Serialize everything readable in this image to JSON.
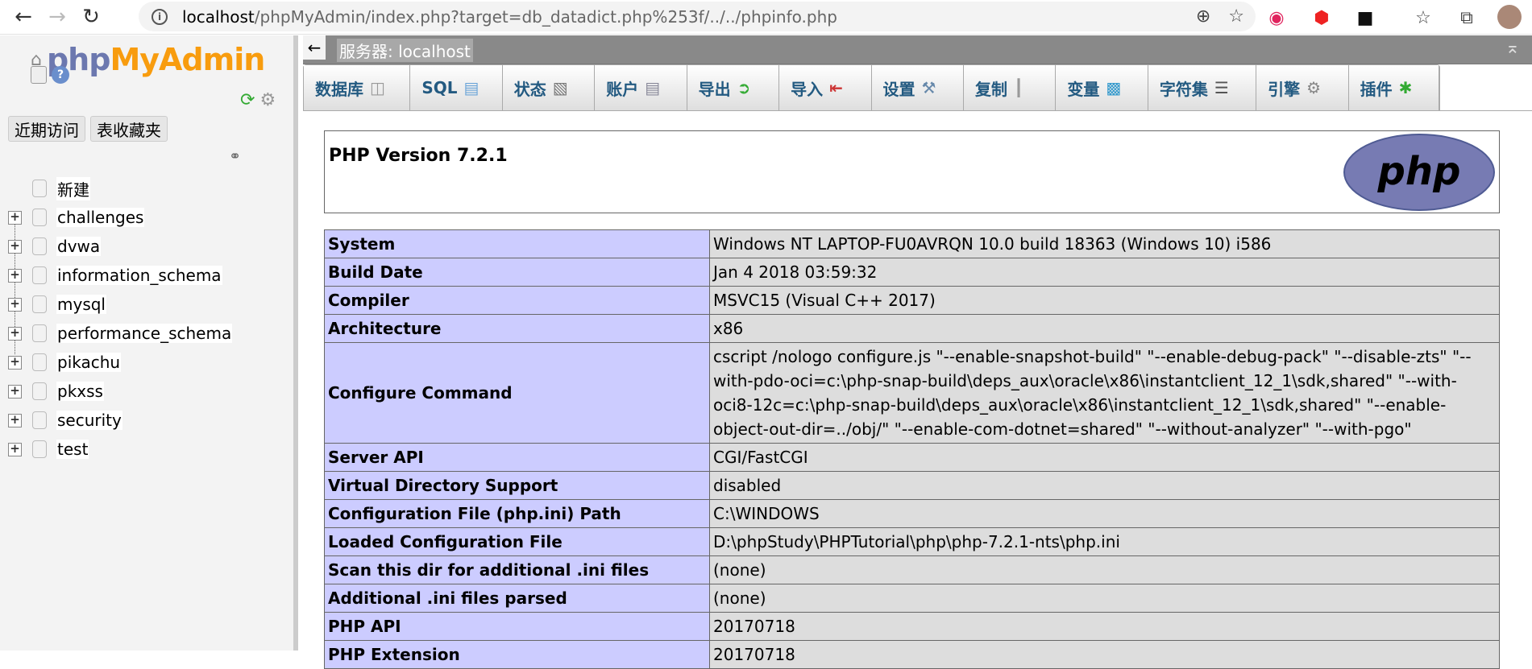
{
  "browser": {
    "url_host": "localhost",
    "url_rest": "/phpMyAdmin/index.php?target=db_datadict.php%253f/../../phpinfo.php"
  },
  "sidebar": {
    "logo_php": "php",
    "logo_myadmin": "MyAdmin",
    "recent_label": "近期访问",
    "favorites_label": "表收藏夹",
    "new_label": "新建",
    "databases": [
      "challenges",
      "dvwa",
      "information_schema",
      "mysql",
      "performance_schema",
      "pikachu",
      "pkxss",
      "security",
      "test"
    ]
  },
  "server_bar": {
    "label": "服务器: localhost"
  },
  "tabs": [
    {
      "label": "数据库",
      "icon": "database-icon"
    },
    {
      "label": "SQL",
      "icon": "sql-icon"
    },
    {
      "label": "状态",
      "icon": "status-icon"
    },
    {
      "label": "账户",
      "icon": "accounts-icon"
    },
    {
      "label": "导出",
      "icon": "export-icon"
    },
    {
      "label": "导入",
      "icon": "import-icon"
    },
    {
      "label": "设置",
      "icon": "settings-icon"
    },
    {
      "label": "复制",
      "icon": "replication-icon"
    },
    {
      "label": "变量",
      "icon": "variables-icon"
    },
    {
      "label": "字符集",
      "icon": "charset-icon"
    },
    {
      "label": "引擎",
      "icon": "engines-icon"
    },
    {
      "label": "插件",
      "icon": "plugins-icon"
    }
  ],
  "phpinfo": {
    "version_title": "PHP Version 7.2.1",
    "logo_text": "php",
    "rows": [
      {
        "k": "System",
        "v": "Windows NT LAPTOP-FU0AVRQN 10.0 build 18363 (Windows 10) i586"
      },
      {
        "k": "Build Date",
        "v": "Jan 4 2018 03:59:32"
      },
      {
        "k": "Compiler",
        "v": "MSVC15 (Visual C++ 2017)"
      },
      {
        "k": "Architecture",
        "v": "x86"
      },
      {
        "k": "Configure Command",
        "v": "cscript /nologo configure.js \"--enable-snapshot-build\" \"--enable-debug-pack\" \"--disable-zts\" \"--with-pdo-oci=c:\\php-snap-build\\deps_aux\\oracle\\x86\\instantclient_12_1\\sdk,shared\" \"--with-oci8-12c=c:\\php-snap-build\\deps_aux\\oracle\\x86\\instantclient_12_1\\sdk,shared\" \"--enable-object-out-dir=../obj/\" \"--enable-com-dotnet=shared\" \"--without-analyzer\" \"--with-pgo\""
      },
      {
        "k": "Server API",
        "v": "CGI/FastCGI"
      },
      {
        "k": "Virtual Directory Support",
        "v": "disabled"
      },
      {
        "k": "Configuration File (php.ini) Path",
        "v": "C:\\WINDOWS"
      },
      {
        "k": "Loaded Configuration File",
        "v": "D:\\phpStudy\\PHPTutorial\\php\\php-7.2.1-nts\\php.ini"
      },
      {
        "k": "Scan this dir for additional .ini files",
        "v": "(none)"
      },
      {
        "k": "Additional .ini files parsed",
        "v": "(none)"
      },
      {
        "k": "PHP API",
        "v": "20170718"
      },
      {
        "k": "PHP Extension",
        "v": "20170718"
      }
    ]
  }
}
